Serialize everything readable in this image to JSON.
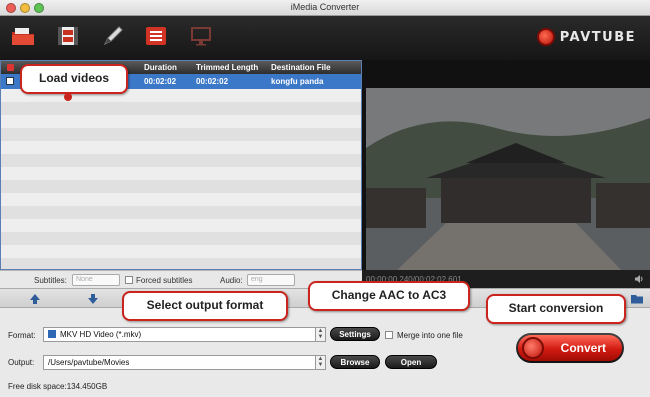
{
  "window": {
    "title": "iMedia Converter",
    "lights": [
      "#ec5f57",
      "#f2bd3f",
      "#5fc355"
    ]
  },
  "toolbar": {
    "icons": [
      "open-folder-icon",
      "load-video-icon",
      "edit-pencil-icon",
      "task-list-icon",
      "display-icon"
    ],
    "brand": "PAVTUBE"
  },
  "filelist": {
    "columns": [
      "Duration",
      "Trimmed Length",
      "Destination File"
    ],
    "rows": [
      {
        "duration": "00:02:02",
        "trimmed": "00:02:02",
        "destination": "kongfu panda"
      }
    ]
  },
  "subtitle_bar": {
    "subtitles_label": "Subtitles:",
    "subtitles_value": "None",
    "forced_label": "Forced subtitles",
    "audio_label": "Audio:",
    "audio_value": "eng"
  },
  "preview": {
    "timecode": "00:00:00.240/00:02:02.601"
  },
  "bottom": {
    "format_label": "Format:",
    "format_value": "MKV HD Video (*.mkv)",
    "settings_button": "Settings",
    "merge_label": "Merge into one file",
    "output_label": "Output:",
    "output_value": "/Users/pavtube/Movies",
    "browse_button": "Browse",
    "open_button": "Open",
    "free_disk": "Free disk space:134.450GB",
    "convert_button": "Convert"
  },
  "callouts": {
    "load": "Load videos",
    "format": "Select output format",
    "settings": "Change AAC to AC3",
    "convert": "Start conversion"
  },
  "colors": {
    "accent_red": "#c9251c",
    "selection_blue": "#3c78c8"
  }
}
